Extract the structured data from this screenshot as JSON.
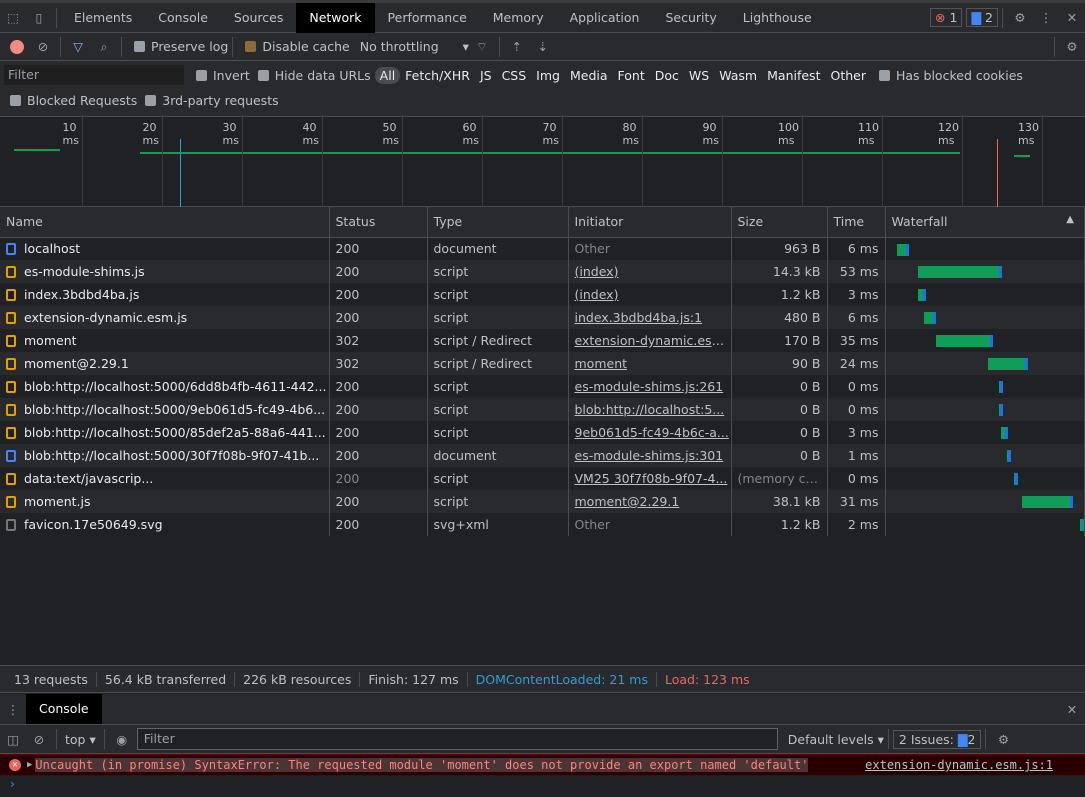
{
  "tabs": [
    "Elements",
    "Console",
    "Sources",
    "Network",
    "Performance",
    "Memory",
    "Application",
    "Security",
    "Lighthouse"
  ],
  "active_tab": "Network",
  "badges": {
    "errors": "1",
    "messages": "2"
  },
  "toolbar": {
    "preserve_log": "Preserve log",
    "disable_cache": "Disable cache",
    "throttling": "No throttling",
    "disable_cache_checked": true
  },
  "filter": {
    "placeholder": "Filter",
    "invert": "Invert",
    "hide_data_urls": "Hide data URLs",
    "types": [
      "All",
      "Fetch/XHR",
      "JS",
      "CSS",
      "Img",
      "Media",
      "Font",
      "Doc",
      "WS",
      "Wasm",
      "Manifest",
      "Other"
    ],
    "has_blocked_cookies": "Has blocked cookies",
    "blocked_requests": "Blocked Requests",
    "third_party": "3rd-party requests"
  },
  "overview_ticks": [
    "10 ms",
    "20 ms",
    "30 ms",
    "40 ms",
    "50 ms",
    "60 ms",
    "70 ms",
    "80 ms",
    "90 ms",
    "100 ms",
    "110 ms",
    "120 ms",
    "130 ms"
  ],
  "columns": [
    "Name",
    "Status",
    "Type",
    "Initiator",
    "Size",
    "Time",
    "Waterfall"
  ],
  "rows": [
    {
      "name": "localhost",
      "status": "200",
      "type": "document",
      "initiator": "Other",
      "size": "963 B",
      "time": "6 ms",
      "icon": "doc",
      "start": 6,
      "dur": 6
    },
    {
      "name": "es-module-shims.js",
      "status": "200",
      "type": "script",
      "initiator": "(index)",
      "size": "14.3 kB",
      "time": "53 ms",
      "icon": "script",
      "start": 20,
      "dur": 53
    },
    {
      "name": "index.3bdbd4ba.js",
      "status": "200",
      "type": "script",
      "initiator": "(index)",
      "size": "1.2 kB",
      "time": "3 ms",
      "icon": "script",
      "start": 20,
      "dur": 3
    },
    {
      "name": "extension-dynamic.esm.js",
      "status": "200",
      "type": "script",
      "initiator": "index.3bdbd4ba.js:1",
      "size": "480 B",
      "time": "6 ms",
      "icon": "script",
      "start": 24,
      "dur": 6
    },
    {
      "name": "moment",
      "status": "302",
      "type": "script / Redirect",
      "initiator": "extension-dynamic.esm...",
      "size": "170 B",
      "time": "35 ms",
      "icon": "script",
      "start": 32,
      "dur": 35
    },
    {
      "name": "moment@2.29.1",
      "status": "302",
      "type": "script / Redirect",
      "initiator": "moment",
      "size": "90 B",
      "time": "24 ms",
      "icon": "script",
      "start": 66,
      "dur": 24
    },
    {
      "name": "blob:http://localhost:5000/6dd8b4fb-4611-442...",
      "status": "200",
      "type": "script",
      "initiator": "es-module-shims.js:261",
      "size": "0 B",
      "time": "0 ms",
      "icon": "script",
      "start": 73,
      "dur": 0
    },
    {
      "name": "blob:http://localhost:5000/9eb061d5-fc49-4b6...",
      "status": "200",
      "type": "script",
      "initiator": "blob:http://localhost:5...",
      "size": "0 B",
      "time": "0 ms",
      "icon": "script",
      "start": 73,
      "dur": 0
    },
    {
      "name": "blob:http://localhost:5000/85def2a5-88a6-441...",
      "status": "200",
      "type": "script",
      "initiator": "9eb061d5-fc49-4b6c-a...",
      "size": "0 B",
      "time": "3 ms",
      "icon": "script",
      "start": 74,
      "dur": 3
    },
    {
      "name": "blob:http://localhost:5000/30f7f08b-9f07-41b...",
      "status": "200",
      "type": "document",
      "initiator": "es-module-shims.js:301",
      "size": "0 B",
      "time": "1 ms",
      "icon": "doc",
      "start": 78,
      "dur": 1
    },
    {
      "name": "data:text/javascrip...",
      "status": "200",
      "type": "script",
      "initiator": "VM25 30f7f08b-9f07-4...",
      "size": "(memory ca...",
      "time": "0 ms",
      "icon": "script",
      "start": 83,
      "dur": 0
    },
    {
      "name": "moment.js",
      "status": "200",
      "type": "script",
      "initiator": "moment@2.29.1",
      "size": "38.1 kB",
      "time": "31 ms",
      "icon": "script",
      "start": 88,
      "dur": 31
    },
    {
      "name": "favicon.17e50649.svg",
      "status": "200",
      "type": "svg+xml",
      "initiator": "Other",
      "size": "1.2 kB",
      "time": "2 ms",
      "icon": "other",
      "start": 126,
      "dur": 2
    }
  ],
  "status": {
    "requests": "13 requests",
    "transferred": "56.4 kB transferred",
    "resources": "226 kB resources",
    "finish": "Finish: 127 ms",
    "dcl": "DOMContentLoaded: 21 ms",
    "load": "Load: 123 ms"
  },
  "drawer": {
    "tab": "Console",
    "context": "top",
    "filter_placeholder": "Filter",
    "levels": "Default levels",
    "issues": "2 Issues:",
    "issues_count": "2"
  },
  "console": {
    "error": "Uncaught (in promise) SyntaxError: The requested module 'moment' does not provide an export named 'default'",
    "source": "extension-dynamic.esm.js:1"
  },
  "colors": {
    "dcl": "#2a9fd6",
    "load": "#e46962",
    "bar": "#0f9d58"
  }
}
